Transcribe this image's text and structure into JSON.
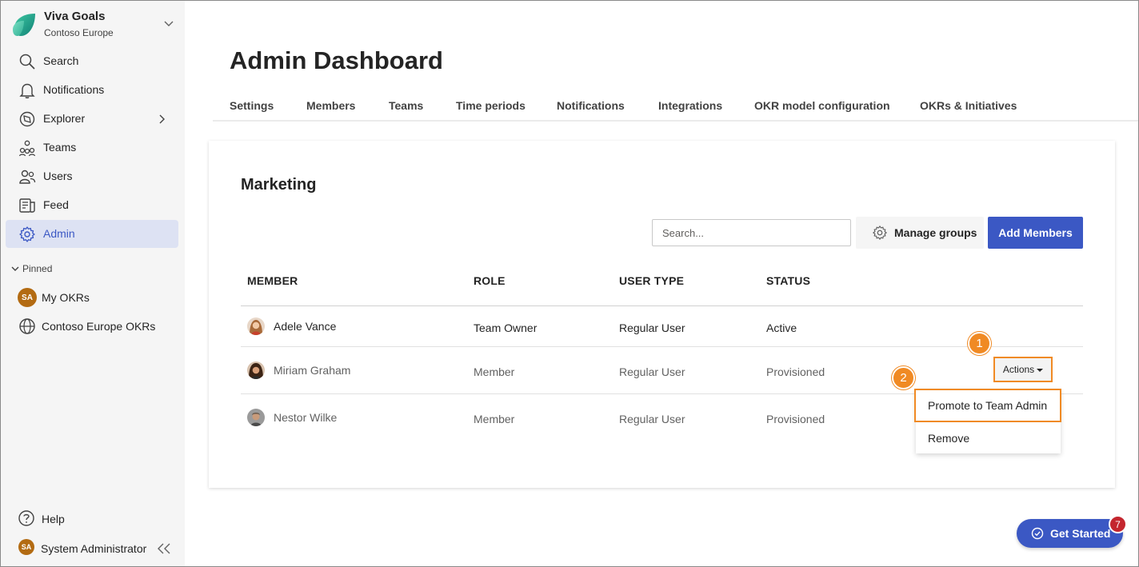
{
  "app": {
    "name": "Viva Goals",
    "org": "Contoso Europe"
  },
  "sidebar": {
    "items": [
      {
        "label": "Search",
        "icon": "search-icon"
      },
      {
        "label": "Notifications",
        "icon": "bell-icon"
      },
      {
        "label": "Explorer",
        "icon": "compass-icon"
      },
      {
        "label": "Teams",
        "icon": "people-team-icon"
      },
      {
        "label": "Users",
        "icon": "people-icon"
      },
      {
        "label": "Feed",
        "icon": "feed-icon"
      },
      {
        "label": "Admin",
        "icon": "gear-icon",
        "active": true
      }
    ],
    "pinned_label": "Pinned",
    "pinned": [
      {
        "label": "My OKRs",
        "avatar": "SA"
      },
      {
        "label": "Contoso Europe OKRs",
        "icon": "globe-icon"
      }
    ],
    "help_label": "Help",
    "user_name": "System Administrator",
    "user_initials": "SA"
  },
  "header": {
    "title": "Admin Dashboard",
    "tabs": [
      "Settings",
      "Members",
      "Teams",
      "Time periods",
      "Notifications",
      "Integrations",
      "OKR model configuration",
      "OKRs & Initiatives"
    ]
  },
  "team": {
    "name": "Marketing",
    "search_placeholder": "Search...",
    "manage_groups_label": "Manage groups",
    "add_members_label": "Add Members",
    "columns": [
      "MEMBER",
      "ROLE",
      "USER TYPE",
      "STATUS"
    ],
    "rows": [
      {
        "member": "Adele Vance",
        "role": "Team Owner",
        "user_type": "Regular User",
        "status": "Active"
      },
      {
        "member": "Miriam Graham",
        "role": "Member",
        "user_type": "Regular User",
        "status": "Provisioned"
      },
      {
        "member": "Nestor Wilke",
        "role": "Member",
        "user_type": "Regular User",
        "status": "Provisioned"
      }
    ],
    "actions_label": "Actions",
    "menu": [
      "Promote to Team Admin",
      "Remove"
    ],
    "callouts": [
      "1",
      "2"
    ]
  },
  "get_started": {
    "label": "Get Started",
    "count": "7"
  },
  "colors": {
    "accent": "#3b58c4",
    "highlight": "#f08a24",
    "badge": "#c4262e"
  }
}
